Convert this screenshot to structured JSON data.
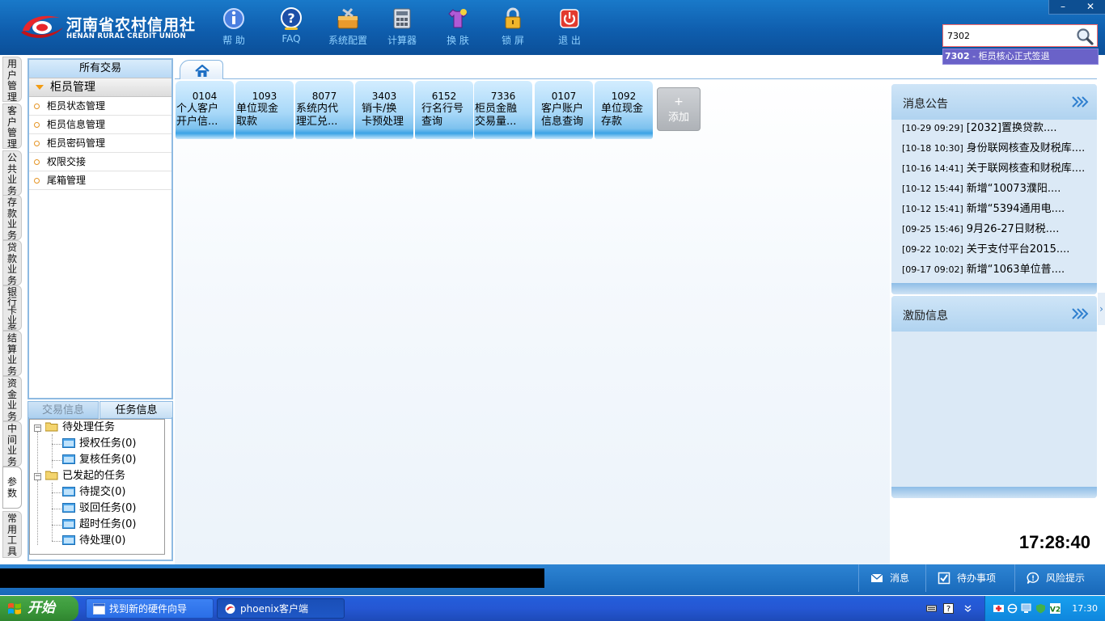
{
  "header": {
    "logo_cn": "河南省农村信用社",
    "logo_en": "HENAN RURAL CREDIT UNION",
    "tools": [
      {
        "label": "帮 助",
        "icon": "help-icon"
      },
      {
        "label": "FAQ",
        "icon": "faq-icon"
      },
      {
        "label": "系统配置",
        "icon": "toolbox-icon"
      },
      {
        "label": "计算器",
        "icon": "calculator-icon"
      },
      {
        "label": "换 肤",
        "icon": "tshirt-icon"
      },
      {
        "label": "锁 屏",
        "icon": "lock-icon"
      },
      {
        "label": "退 出",
        "icon": "power-icon"
      }
    ],
    "window_controls": {
      "minimize": "–",
      "close": "✕"
    },
    "search": {
      "value": "7302",
      "suggestion_code": "7302",
      "suggestion_text": " - 柜员核心正式签退"
    }
  },
  "vnav": {
    "tabs": [
      "用户管理",
      "客户管理",
      "公共业务",
      "存款业务",
      "贷款业务",
      "银行卡业务",
      "结算业务",
      "资金业务",
      "中间业务",
      "参数",
      "常用工具"
    ]
  },
  "left_panel": {
    "title": "所有交易",
    "group": "柜员管理",
    "items": [
      "柜员状态管理",
      "柜员信息管理",
      "柜员密码管理",
      "权限交接",
      "尾箱管理"
    ]
  },
  "left_tabs": {
    "trade": "交易信息",
    "task": "任务信息"
  },
  "tree": {
    "pending_root": "待处理任务",
    "pending": [
      "授权任务(0)",
      "复核任务(0)"
    ],
    "initiated_root": "已发起的任务",
    "initiated": [
      "待提交(0)",
      "驳回任务(0)",
      "超时任务(0)",
      "待处理(0)"
    ]
  },
  "tiles": [
    {
      "code": "0104",
      "name": "个人客户\n开户信..."
    },
    {
      "code": "1093",
      "name": "单位现金\n取款"
    },
    {
      "code": "8077",
      "name": "系统内代\n理汇兑..."
    },
    {
      "code": "3403",
      "name": "销卡/换\n卡预处理"
    },
    {
      "code": "6152",
      "name": "行名行号\n查询"
    },
    {
      "code": "7336",
      "name": "柜员金融\n交易量..."
    },
    {
      "code": "0107",
      "name": "客户账户\n信息查询"
    },
    {
      "code": "1092",
      "name": "单位现金\n存款"
    }
  ],
  "add_tile": {
    "plus": "+",
    "label": "添加"
  },
  "news": {
    "title": "消息公告",
    "items": [
      {
        "date": "[10-29 09:29]",
        "text": "[2032]置换贷款...."
      },
      {
        "date": "[10-18 10:30]",
        "text": "身份联网核查及财税库...."
      },
      {
        "date": "[10-16 14:41]",
        "text": "关于联网核查和财税库...."
      },
      {
        "date": "[10-12 15:44]",
        "text": "新增“10073濮阳...."
      },
      {
        "date": "[10-12 15:41]",
        "text": "新增“5394通用电...."
      },
      {
        "date": "[09-25 15:46]",
        "text": "9月26-27日财税...."
      },
      {
        "date": "[09-22 10:02]",
        "text": "关于支付平台2015...."
      },
      {
        "date": "[09-17 09:02]",
        "text": "新增“1063单位普...."
      }
    ]
  },
  "incentive": {
    "title": "激励信息"
  },
  "clock": "17:28:40",
  "status_bar": {
    "message": "消息",
    "todo": "待办事项",
    "risk": "风险提示"
  },
  "taskbar": {
    "start": "开始",
    "tasks": [
      "找到新的硬件向导",
      "phoenix客户端"
    ],
    "time": "17:30"
  },
  "colors": {
    "header_blue": "#0f5eae",
    "tile_blue": "#7cc1ee",
    "suggest_purple": "#6a62c8"
  }
}
